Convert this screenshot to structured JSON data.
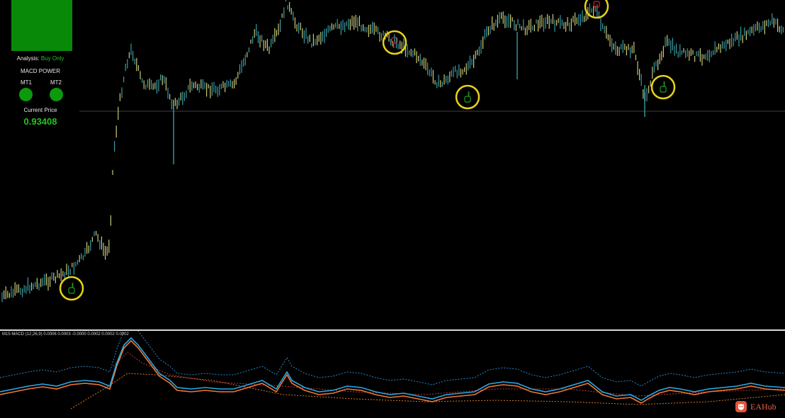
{
  "panel": {
    "analysis_label": "Analysis:",
    "analysis_value": "Buy Only",
    "macd_power_title": "MACD POWER",
    "mt1_label": "MT1",
    "mt2_label": "MT2",
    "current_price_label": "Current Price",
    "current_price_value": "0.93408"
  },
  "macd_caption": "M15 MACD (12,26,9) 0.0006 0.0003 -0.0000 0.0002 0.0002 0.0002",
  "watermark": "EAHub",
  "colors": {
    "background": "#000000",
    "signal_box": "#088a08",
    "status_dot": "#0c9a0c",
    "analysis_value": "#1ec81e",
    "price_value": "#22c422",
    "candle_up": "#c8c878",
    "candle_down": "#3a9aa0",
    "marker_ring": "#e8d21a",
    "buy_hand": "#20a020",
    "sell_hand": "#e02020",
    "macd_line": "#2aa8e8",
    "signal_line": "#f07830",
    "band_blue": "#2a88c8",
    "band_red": "#c03a30",
    "band_orange": "#d87a28",
    "price_line": "#404040"
  },
  "markers": [
    {
      "type": "buy",
      "icon": "hand-pointing-up-icon"
    },
    {
      "type": "sell",
      "icon": "hand-pointing-down-icon"
    },
    {
      "type": "buy",
      "icon": "hand-pointing-up-icon"
    },
    {
      "type": "sell",
      "icon": "hand-pointing-down-icon"
    },
    {
      "type": "buy",
      "icon": "hand-pointing-up-icon"
    }
  ]
}
